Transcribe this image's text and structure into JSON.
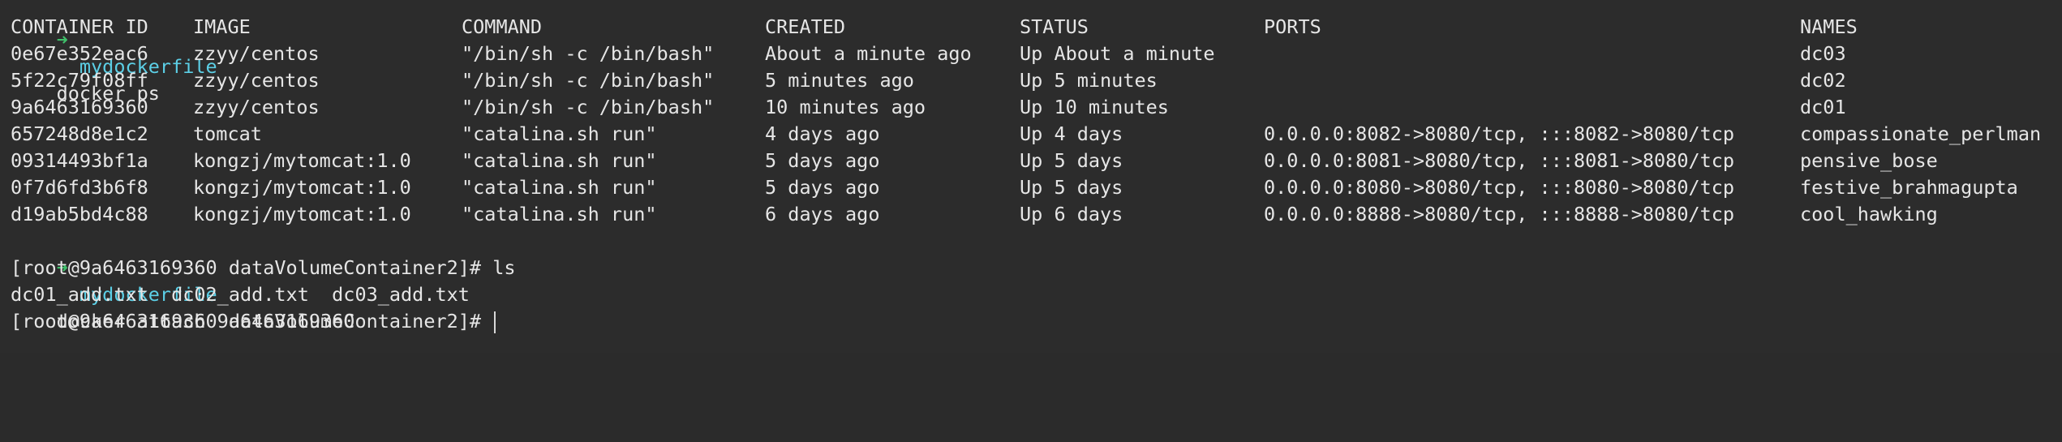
{
  "prompt_symbol": "➜",
  "first_command": {
    "dir": "mydockerfile",
    "cmd": "docker ps"
  },
  "ps_table": {
    "headers": [
      "CONTAINER ID",
      "IMAGE",
      "COMMAND",
      "CREATED",
      "STATUS",
      "PORTS",
      "NAMES"
    ],
    "rows": [
      [
        "0e67e352eac6",
        "zzyy/centos",
        "\"/bin/sh -c /bin/bash\"",
        "About a minute ago",
        "Up About a minute",
        "",
        "dc03"
      ],
      [
        "5f22c79f08ff",
        "zzyy/centos",
        "\"/bin/sh -c /bin/bash\"",
        "5 minutes ago",
        "Up 5 minutes",
        "",
        "dc02"
      ],
      [
        "9a6463169360",
        "zzyy/centos",
        "\"/bin/sh -c /bin/bash\"",
        "10 minutes ago",
        "Up 10 minutes",
        "",
        "dc01"
      ],
      [
        "657248d8e1c2",
        "tomcat",
        "\"catalina.sh run\"",
        "4 days ago",
        "Up 4 days",
        "0.0.0.0:8082->8080/tcp, :::8082->8080/tcp",
        "compassionate_perlman"
      ],
      [
        "09314493bf1a",
        "kongzj/mytomcat:1.0",
        "\"catalina.sh run\"",
        "5 days ago",
        "Up 5 days",
        "0.0.0.0:8081->8080/tcp, :::8081->8080/tcp",
        "pensive_bose"
      ],
      [
        "0f7d6fd3b6f8",
        "kongzj/mytomcat:1.0",
        "\"catalina.sh run\"",
        "5 days ago",
        "Up 5 days",
        "0.0.0.0:8080->8080/tcp, :::8080->8080/tcp",
        "festive_brahmagupta"
      ],
      [
        "d19ab5bd4c88",
        "kongzj/mytomcat:1.0",
        "\"catalina.sh run\"",
        "6 days ago",
        "Up 6 days",
        "0.0.0.0:8888->8080/tcp, :::8888->8080/tcp",
        "cool_hawking"
      ]
    ]
  },
  "second_command": {
    "dir": "mydockerfile",
    "cmd": "docker attach 9a6463169360"
  },
  "shell_prompt": "[root@9a6463169360 dataVolumeContainer2]# ",
  "ls_command": "ls",
  "ls_output": "dc01_add.txt  dc02_add.txt  dc03_add.txt",
  "colors": {
    "background": "#2c2c2c",
    "text": "#e6e6e6",
    "prompt_arrow": "#3fbf6a",
    "prompt_dir": "#5ccfe6"
  }
}
